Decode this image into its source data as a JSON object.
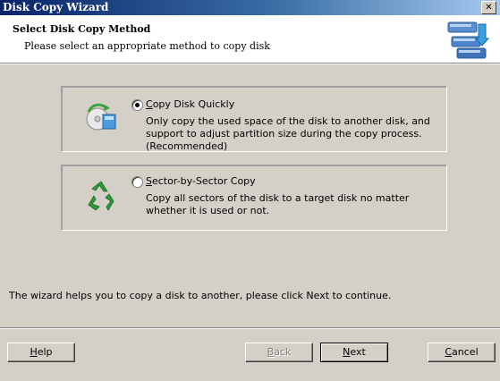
{
  "window": {
    "title": "Disk Copy Wizard",
    "close_glyph": "✕"
  },
  "header": {
    "title": "Select Disk Copy Method",
    "subtitle": "Please select an appropriate method to copy disk",
    "icon": "disk-copy-icon"
  },
  "options": [
    {
      "label_hotkey": "C",
      "label_rest": "opy Disk Quickly",
      "description": "Only copy the used space of the disk to another disk, and support to adjust partition size during the copy process.(Recommended)",
      "selected": true,
      "icon": "disk-quick-copy-icon"
    },
    {
      "label_hotkey": "S",
      "label_rest": "ector-by-Sector Copy",
      "description": "Copy all sectors of the disk to a target disk no matter whether it is used or not.",
      "selected": false,
      "icon": "recycle-icon"
    }
  ],
  "footer": {
    "message": "The wizard helps you to copy a disk to another, please click Next to continue."
  },
  "buttons": {
    "help": {
      "hotkey": "H",
      "rest": "elp"
    },
    "back": {
      "hotkey": "B",
      "rest": "ack",
      "enabled": false
    },
    "next": {
      "hotkey": "N",
      "rest": "ext"
    },
    "cancel": {
      "hotkey": "C",
      "rest": "ancel"
    }
  },
  "colors": {
    "title_start": "#0a246a",
    "title_end": "#a6caf0",
    "face": "#d4d0c8",
    "recycle_green": "#2e9b3a"
  }
}
